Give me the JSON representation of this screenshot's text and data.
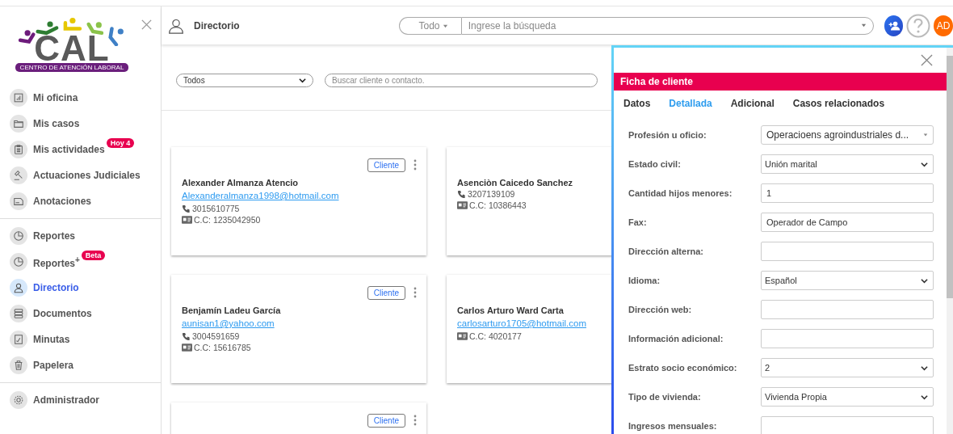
{
  "logo": {
    "title": "CAL",
    "subtitle": "CENTRO DE ATENCIÓN LABORAL"
  },
  "sidebar": {
    "groups": [
      [
        {
          "label": "Mi oficina",
          "selected": false
        },
        {
          "label": "Mis casos",
          "selected": false
        },
        {
          "label": "Mis actividades",
          "selected": false,
          "badge": "Hoy 4"
        },
        {
          "label": "Actuaciones Judiciales",
          "selected": false
        },
        {
          "label": "Anotaciones",
          "selected": false
        }
      ],
      [
        {
          "label": "Reportes",
          "selected": false
        },
        {
          "label": "Reportes$^{+}$",
          "selected": false,
          "badge": "Beta"
        },
        {
          "label": "Directorio",
          "selected": true
        },
        {
          "label": "Documentos",
          "selected": false
        },
        {
          "label": "Minutas",
          "selected": false
        },
        {
          "label": "Papelera",
          "selected": false
        }
      ],
      [
        {
          "label": "Administrador",
          "selected": false
        }
      ]
    ]
  },
  "header": {
    "title": "Directorio",
    "scope": "Todo",
    "search_placeholder": "Ingrese la búsqueda",
    "avatar": "AD"
  },
  "filters": {
    "type": "Todos",
    "search_placeholder": "Buscar cliente o contacto."
  },
  "cards": [
    {
      "tag": "Cliente",
      "name": "Alexander Almanza Atencio",
      "email": "Alexanderalmanza1998@hotmail.com",
      "phone": "3015610775",
      "doc": "C.C: 1235042950"
    },
    {
      "name": "Asenciòn Caicedo Sanchez",
      "phone": "3207139109",
      "doc": "C.C: 10386443"
    },
    {
      "tag": "Cliente",
      "name": "Benjamín Ladeu García",
      "email": "aunisan1@yahoo.com",
      "phone": "3004591659",
      "doc": "C.C: 15616785"
    },
    {
      "name": "Carlos Arturo Ward Carta",
      "email": "carlosarturo1705@hotmail.com",
      "doc": "C.C: 4020177"
    },
    {
      "tag": "Cliente"
    }
  ],
  "panel": {
    "title": "Ficha de cliente",
    "tabs": [
      {
        "label": "Datos",
        "selected": false
      },
      {
        "label": "Detallada",
        "selected": true
      },
      {
        "label": "Adicional",
        "selected": false
      },
      {
        "label": "Casos relacionados",
        "selected": false
      }
    ],
    "fields": [
      {
        "label": "Profesión u oficio:",
        "kind": "combo",
        "value": "Operacioens agroindustriales d..."
      },
      {
        "label": "Estado civil:",
        "kind": "select",
        "value": "Unión marital"
      },
      {
        "label": "Cantidad hijos menores:",
        "kind": "input",
        "value": "1"
      },
      {
        "label": "Fax:",
        "kind": "input",
        "value": "Operador de Campo"
      },
      {
        "label": "Dirección alterna:",
        "kind": "input"
      },
      {
        "label": "Idioma:",
        "kind": "select",
        "value": "Español"
      },
      {
        "label": "Dirección web:",
        "kind": "input"
      },
      {
        "label": "Información adicional:",
        "kind": "input"
      },
      {
        "label": "Estrato socio económico:",
        "kind": "select",
        "value": "2"
      },
      {
        "label": "Tipo de vivienda:",
        "kind": "select",
        "value": "Vivienda Propia"
      },
      {
        "label": "Ingresos mensuales:",
        "kind": "input"
      }
    ]
  }
}
